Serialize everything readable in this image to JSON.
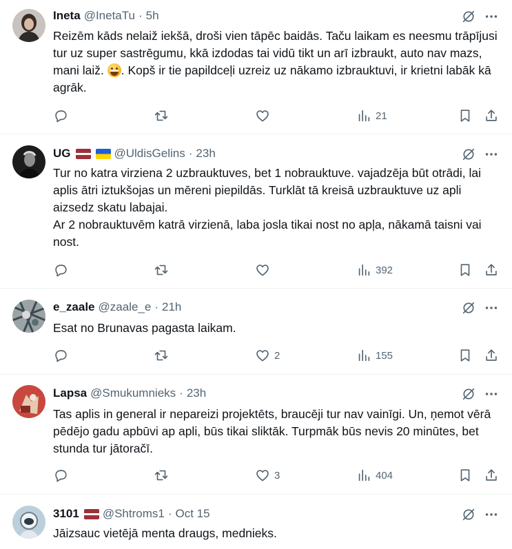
{
  "colors": {
    "text": "#0f1419",
    "secondary": "#536471",
    "divider": "#eff3f4"
  },
  "icons": [
    "reply-icon",
    "retweet-icon",
    "like-icon",
    "views-icon",
    "bookmark-icon",
    "share-icon",
    "grok-icon",
    "more-icon"
  ],
  "tweets": [
    {
      "name": "Ineta",
      "handle": "@InetaTu",
      "separator": "·",
      "time": "5h",
      "flags": [],
      "text_before_emoji": "Reizēm kāds nelaiž iekšā, droši vien tāpēc baidās. Taču laikam es neesmu trāpījusi tur uz super sastrēgumu, kkā izdodas tai vidū tikt un arī izbraukt, auto nav mazs, mani laiž. ",
      "text_after_emoji": ". Kopš ir tie papildceļi uzreiz uz nākamo izbrauktuvi, ir krietni labāk kā agrāk.",
      "replies": "",
      "retweets": "",
      "likes": "",
      "views": "21"
    },
    {
      "name": "UG",
      "handle": "@UldisGelins",
      "separator": "·",
      "time": "23h",
      "flags": [
        "latvia",
        "ukraine"
      ],
      "text": "Tur no katra virziena 2 uzbrauktuves, bet 1 nobrauktuve. vajadzēja būt otrādi, lai aplis ātri iztukšojas un mēreni piepildās. Turklāt tā kreisā uzbrauktuve uz apli aizsedz skatu labajai.\nAr 2 nobrauktuvēm katrā virzienā, laba josla tikai nost no apļa, nākamā taisni vai nost.",
      "replies": "",
      "retweets": "",
      "likes": "",
      "views": "392"
    },
    {
      "name": "e_zaale",
      "handle": "@zaale_e",
      "separator": "·",
      "time": "21h",
      "flags": [],
      "text": "Esat no Brunavas pagasta laikam.",
      "replies": "",
      "retweets": "",
      "likes": "2",
      "views": "155"
    },
    {
      "name": "Lapsa",
      "handle": "@Smukumnieks",
      "separator": "·",
      "time": "23h",
      "flags": [],
      "text": "Tas aplis in general ir nepareizi projektēts, braucēji tur nav vainīgi. Un, ņemot vērā pēdējo gadu apbūvi ap apli, būs tikai sliktāk. Turpmāk būs nevis 20 minūtes, bet stunda tur jātoračī.",
      "replies": "",
      "retweets": "",
      "likes": "3",
      "views": "404"
    },
    {
      "name": "3101",
      "handle": "@Shtroms1",
      "separator": "·",
      "time": "Oct 15",
      "flags": [
        "latvia"
      ],
      "text": "Jāizsauc vietējā menta draugs, mednieks."
    }
  ]
}
